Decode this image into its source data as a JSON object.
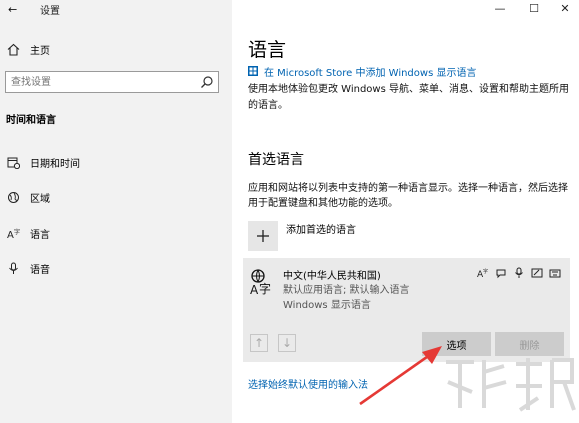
{
  "window": {
    "title": "设置",
    "back_glyph": "←",
    "minimize_glyph": "—",
    "maximize_glyph": "☐",
    "close_glyph": "✕"
  },
  "sidebar": {
    "home_label": "主页",
    "search_placeholder": "查找设置",
    "section_title": "时间和语言",
    "items": [
      {
        "label": "日期和时间",
        "icon": "calendar-clock-icon"
      },
      {
        "label": "区域",
        "icon": "globe-icon"
      },
      {
        "label": "语言",
        "icon": "language-icon"
      },
      {
        "label": "语音",
        "icon": "microphone-icon"
      }
    ]
  },
  "main": {
    "title": "语言",
    "store_link": "在 Microsoft Store 中添加 Windows 显示语言",
    "description": "使用本地体验包更改 Windows 导航、菜单、消息、设置和帮助主题所用的语言。",
    "preferred_heading": "首选语言",
    "preferred_description": "应用和网站将以列表中支持的第一种语言显示。选择一种语言，然后选择用于配置键盘和其他功能的选项。",
    "add_language_label": "添加首选的语言",
    "language_card": {
      "name": "中文(中华人民共和国)",
      "sub1": "默认应用语言; 默认输入语言",
      "sub2": "Windows 显示语言",
      "up_glyph": "↑",
      "down_glyph": "↓",
      "options_label": "选项",
      "remove_label": "删除"
    },
    "bottom_link": "选择始终默认使用的输入法"
  },
  "colors": {
    "accent": "#0063b1",
    "sidebar_bg": "#f2f2f2",
    "card_bg": "#eaeaea",
    "annotation": "#e53935"
  }
}
